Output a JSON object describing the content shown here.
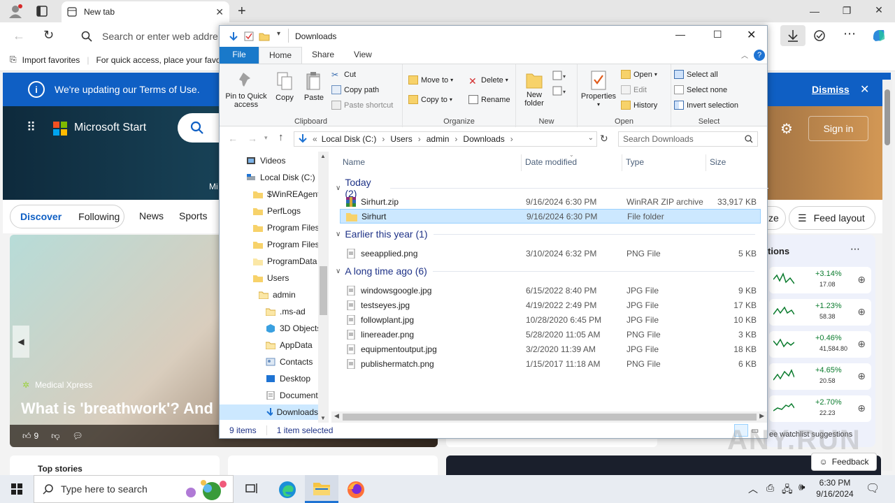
{
  "browser": {
    "tab_title": "New tab",
    "omnibox_placeholder": "Search or enter web addre",
    "favorites": {
      "import_label": "Import favorites",
      "hint": "For quick access, place your favo"
    }
  },
  "msn": {
    "terms_text": "We're updating our Terms of Use.",
    "dismiss": "Dismiss",
    "brand": "Microsoft Start",
    "signin": "Sign in",
    "hero_fragment": "Mi",
    "tabs": [
      "Discover",
      "Following",
      "News",
      "Sports"
    ],
    "feed_layout": "Feed layout",
    "pill_fragment": "ze",
    "story_source": "Medical Xpress",
    "story_title": "What is 'breathwork'? And",
    "likes": "9",
    "watchlist_header": "tions",
    "watchlist": [
      {
        "pct": "+3.14%",
        "val": "17.08"
      },
      {
        "pct": "+1.23%",
        "val": "58.38"
      },
      {
        "pct": "+0.46%",
        "val": "41,584.80"
      },
      {
        "pct": "+4.65%",
        "val": "20.58"
      },
      {
        "pct": "+2.70%",
        "val": "22.23"
      }
    ],
    "watchlist_footer": "ee watchlist suggestions",
    "top_stories": "Top stories",
    "feedback": "Feedback"
  },
  "explorer": {
    "title": "Downloads",
    "ribbon_tabs": [
      "File",
      "Home",
      "Share",
      "View"
    ],
    "clipboard": {
      "pin": "Pin to Quick access",
      "copy": "Copy",
      "paste": "Paste",
      "cut": "Cut",
      "copy_path": "Copy path",
      "paste_shortcut": "Paste shortcut",
      "group": "Clipboard"
    },
    "organize": {
      "move_to": "Move to",
      "copy_to": "Copy to",
      "delete": "Delete",
      "rename": "Rename",
      "group": "Organize"
    },
    "new": {
      "new_folder": "New folder",
      "group": "New"
    },
    "open": {
      "properties": "Properties",
      "open": "Open",
      "edit": "Edit",
      "history": "History",
      "group": "Open"
    },
    "select": {
      "select_all": "Select all",
      "select_none": "Select none",
      "invert": "Invert selection",
      "group": "Select"
    },
    "address": [
      "Local Disk (C:)",
      "Users",
      "admin",
      "Downloads"
    ],
    "search_placeholder": "Search Downloads",
    "tree": [
      "Videos",
      "Local Disk (C:)",
      "$WinREAgent",
      "PerfLogs",
      "Program Files",
      "Program Files",
      "ProgramData",
      "Users",
      "admin",
      ".ms-ad",
      "3D Objects",
      "AppData",
      "Contacts",
      "Desktop",
      "Documents",
      "Downloads"
    ],
    "columns": [
      "Name",
      "Date modified",
      "Type",
      "Size"
    ],
    "groups": [
      {
        "label": "Today (2)",
        "files": [
          {
            "name": "Sirhurt.zip",
            "date": "9/16/2024 6:30 PM",
            "type": "WinRAR ZIP archive",
            "size": "33,917 KB"
          },
          {
            "name": "Sirhurt",
            "date": "9/16/2024 6:30 PM",
            "type": "File folder",
            "size": ""
          }
        ]
      },
      {
        "label": "Earlier this year (1)",
        "files": [
          {
            "name": "seeapplied.png",
            "date": "3/10/2024 6:32 PM",
            "type": "PNG File",
            "size": "5 KB"
          }
        ]
      },
      {
        "label": "A long time ago (6)",
        "files": [
          {
            "name": "windowsgoogle.jpg",
            "date": "6/15/2022 8:40 PM",
            "type": "JPG File",
            "size": "9 KB"
          },
          {
            "name": "testseyes.jpg",
            "date": "4/19/2022 2:49 PM",
            "type": "JPG File",
            "size": "17 KB"
          },
          {
            "name": "followplant.jpg",
            "date": "10/28/2020 6:45 PM",
            "type": "JPG File",
            "size": "10 KB"
          },
          {
            "name": "linereader.png",
            "date": "5/28/2020 11:05 AM",
            "type": "PNG File",
            "size": "3 KB"
          },
          {
            "name": "equipmentoutput.jpg",
            "date": "3/2/2020 11:39 AM",
            "type": "JPG File",
            "size": "18 KB"
          },
          {
            "name": "publishermatch.png",
            "date": "1/15/2017 11:18 AM",
            "type": "PNG File",
            "size": "6 KB"
          }
        ]
      }
    ],
    "status_items": "9 items",
    "status_selected": "1 item selected"
  },
  "taskbar": {
    "search_placeholder": "Type here to search",
    "time": "6:30 PM",
    "date": "9/16/2024"
  },
  "watermark": "ANY.RUN"
}
